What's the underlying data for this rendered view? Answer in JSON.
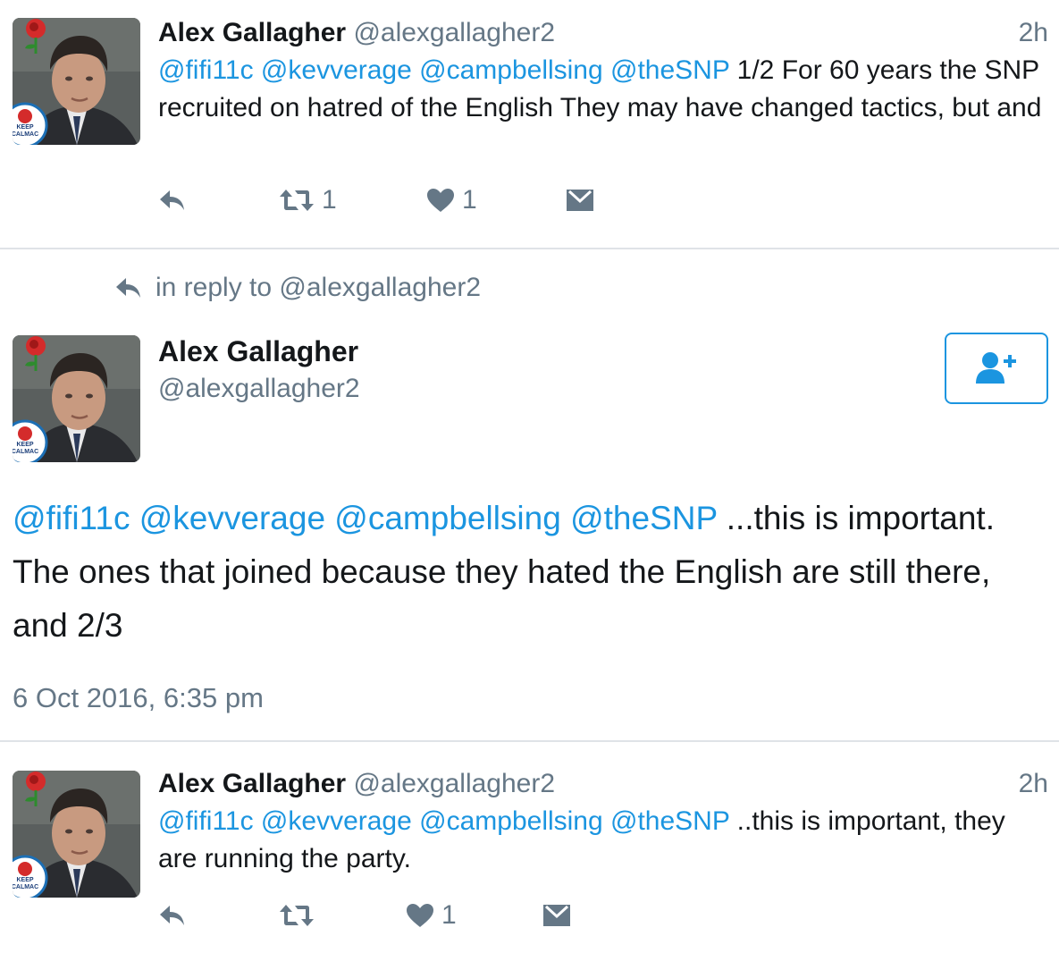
{
  "tweet1": {
    "name": "Alex Gallagher",
    "handle": "@alexgallagher2",
    "time": "2h",
    "mentions": "@fifi11c @kevverage @campbellsing @theSNP",
    "text": " 1/2 For 60 years the SNP recruited on hatred of the English They may have changed tactics, but and",
    "retweets": "1",
    "likes": "1"
  },
  "reply_context": "in reply to @alexgallagher2",
  "focus": {
    "name": "Alex Gallagher",
    "handle": "@alexgallagher2",
    "mentions": "@fifi11c @kevverage @campbellsing @theSNP",
    "text": " ...this is important. The ones that joined because they hated the English are still there, and 2/3",
    "timestamp": "6 Oct 2016, 6:35 pm"
  },
  "tweet3": {
    "name": "Alex Gallagher",
    "handle": "@alexgallagher2",
    "time": "2h",
    "mentions": "@fifi11c @kevverage @campbellsing @theSNP",
    "text": " ..this is important, they are running the party.",
    "likes": "1"
  },
  "icons": {
    "reply": "reply-arrow-icon",
    "retweet": "retweet-icon",
    "like": "heart-icon",
    "dm": "envelope-icon",
    "follow": "add-user-icon",
    "avatar_badge": "rose-icon"
  },
  "colors": {
    "accent": "#1b95e0",
    "muted": "#657786",
    "text": "#14171a",
    "divider": "#dfe3e7"
  },
  "avatar_badge_text": [
    "KEEP",
    "CALMAC"
  ]
}
